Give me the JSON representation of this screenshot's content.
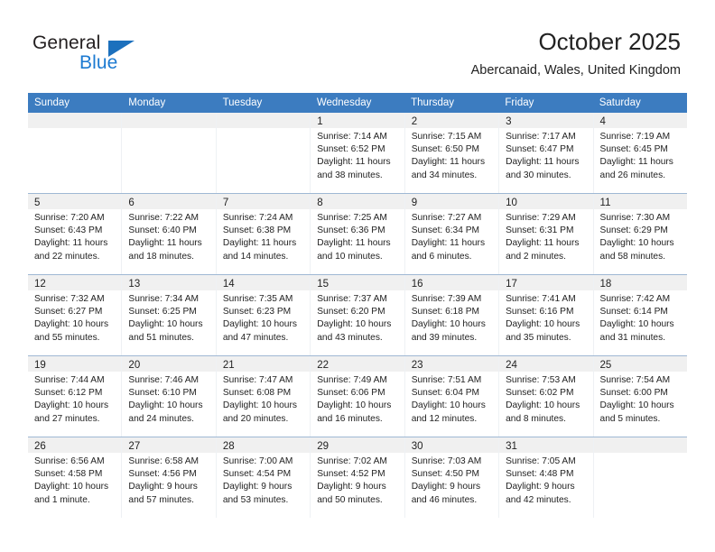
{
  "brand": {
    "name_top": "General",
    "name_bottom": "Blue",
    "triangle_color": "#1c70bd",
    "blue_color": "#1c7ad1"
  },
  "header": {
    "title": "October 2025",
    "subtitle": "Abercanaid, Wales, United Kingdom"
  },
  "theme": {
    "header_row_bg": "#3c7cc0",
    "daynum_bg": "#f0f0f0",
    "grid_line": "#9fb8d4",
    "text": "#222222"
  },
  "weekdays": [
    "Sunday",
    "Monday",
    "Tuesday",
    "Wednesday",
    "Thursday",
    "Friday",
    "Saturday"
  ],
  "weeks": [
    [
      {
        "day": "",
        "sunrise": "",
        "sunset": "",
        "daylight1": "",
        "daylight2": ""
      },
      {
        "day": "",
        "sunrise": "",
        "sunset": "",
        "daylight1": "",
        "daylight2": ""
      },
      {
        "day": "",
        "sunrise": "",
        "sunset": "",
        "daylight1": "",
        "daylight2": ""
      },
      {
        "day": "1",
        "sunrise": "Sunrise: 7:14 AM",
        "sunset": "Sunset: 6:52 PM",
        "daylight1": "Daylight: 11 hours",
        "daylight2": "and 38 minutes."
      },
      {
        "day": "2",
        "sunrise": "Sunrise: 7:15 AM",
        "sunset": "Sunset: 6:50 PM",
        "daylight1": "Daylight: 11 hours",
        "daylight2": "and 34 minutes."
      },
      {
        "day": "3",
        "sunrise": "Sunrise: 7:17 AM",
        "sunset": "Sunset: 6:47 PM",
        "daylight1": "Daylight: 11 hours",
        "daylight2": "and 30 minutes."
      },
      {
        "day": "4",
        "sunrise": "Sunrise: 7:19 AM",
        "sunset": "Sunset: 6:45 PM",
        "daylight1": "Daylight: 11 hours",
        "daylight2": "and 26 minutes."
      }
    ],
    [
      {
        "day": "5",
        "sunrise": "Sunrise: 7:20 AM",
        "sunset": "Sunset: 6:43 PM",
        "daylight1": "Daylight: 11 hours",
        "daylight2": "and 22 minutes."
      },
      {
        "day": "6",
        "sunrise": "Sunrise: 7:22 AM",
        "sunset": "Sunset: 6:40 PM",
        "daylight1": "Daylight: 11 hours",
        "daylight2": "and 18 minutes."
      },
      {
        "day": "7",
        "sunrise": "Sunrise: 7:24 AM",
        "sunset": "Sunset: 6:38 PM",
        "daylight1": "Daylight: 11 hours",
        "daylight2": "and 14 minutes."
      },
      {
        "day": "8",
        "sunrise": "Sunrise: 7:25 AM",
        "sunset": "Sunset: 6:36 PM",
        "daylight1": "Daylight: 11 hours",
        "daylight2": "and 10 minutes."
      },
      {
        "day": "9",
        "sunrise": "Sunrise: 7:27 AM",
        "sunset": "Sunset: 6:34 PM",
        "daylight1": "Daylight: 11 hours",
        "daylight2": "and 6 minutes."
      },
      {
        "day": "10",
        "sunrise": "Sunrise: 7:29 AM",
        "sunset": "Sunset: 6:31 PM",
        "daylight1": "Daylight: 11 hours",
        "daylight2": "and 2 minutes."
      },
      {
        "day": "11",
        "sunrise": "Sunrise: 7:30 AM",
        "sunset": "Sunset: 6:29 PM",
        "daylight1": "Daylight: 10 hours",
        "daylight2": "and 58 minutes."
      }
    ],
    [
      {
        "day": "12",
        "sunrise": "Sunrise: 7:32 AM",
        "sunset": "Sunset: 6:27 PM",
        "daylight1": "Daylight: 10 hours",
        "daylight2": "and 55 minutes."
      },
      {
        "day": "13",
        "sunrise": "Sunrise: 7:34 AM",
        "sunset": "Sunset: 6:25 PM",
        "daylight1": "Daylight: 10 hours",
        "daylight2": "and 51 minutes."
      },
      {
        "day": "14",
        "sunrise": "Sunrise: 7:35 AM",
        "sunset": "Sunset: 6:23 PM",
        "daylight1": "Daylight: 10 hours",
        "daylight2": "and 47 minutes."
      },
      {
        "day": "15",
        "sunrise": "Sunrise: 7:37 AM",
        "sunset": "Sunset: 6:20 PM",
        "daylight1": "Daylight: 10 hours",
        "daylight2": "and 43 minutes."
      },
      {
        "day": "16",
        "sunrise": "Sunrise: 7:39 AM",
        "sunset": "Sunset: 6:18 PM",
        "daylight1": "Daylight: 10 hours",
        "daylight2": "and 39 minutes."
      },
      {
        "day": "17",
        "sunrise": "Sunrise: 7:41 AM",
        "sunset": "Sunset: 6:16 PM",
        "daylight1": "Daylight: 10 hours",
        "daylight2": "and 35 minutes."
      },
      {
        "day": "18",
        "sunrise": "Sunrise: 7:42 AM",
        "sunset": "Sunset: 6:14 PM",
        "daylight1": "Daylight: 10 hours",
        "daylight2": "and 31 minutes."
      }
    ],
    [
      {
        "day": "19",
        "sunrise": "Sunrise: 7:44 AM",
        "sunset": "Sunset: 6:12 PM",
        "daylight1": "Daylight: 10 hours",
        "daylight2": "and 27 minutes."
      },
      {
        "day": "20",
        "sunrise": "Sunrise: 7:46 AM",
        "sunset": "Sunset: 6:10 PM",
        "daylight1": "Daylight: 10 hours",
        "daylight2": "and 24 minutes."
      },
      {
        "day": "21",
        "sunrise": "Sunrise: 7:47 AM",
        "sunset": "Sunset: 6:08 PM",
        "daylight1": "Daylight: 10 hours",
        "daylight2": "and 20 minutes."
      },
      {
        "day": "22",
        "sunrise": "Sunrise: 7:49 AM",
        "sunset": "Sunset: 6:06 PM",
        "daylight1": "Daylight: 10 hours",
        "daylight2": "and 16 minutes."
      },
      {
        "day": "23",
        "sunrise": "Sunrise: 7:51 AM",
        "sunset": "Sunset: 6:04 PM",
        "daylight1": "Daylight: 10 hours",
        "daylight2": "and 12 minutes."
      },
      {
        "day": "24",
        "sunrise": "Sunrise: 7:53 AM",
        "sunset": "Sunset: 6:02 PM",
        "daylight1": "Daylight: 10 hours",
        "daylight2": "and 8 minutes."
      },
      {
        "day": "25",
        "sunrise": "Sunrise: 7:54 AM",
        "sunset": "Sunset: 6:00 PM",
        "daylight1": "Daylight: 10 hours",
        "daylight2": "and 5 minutes."
      }
    ],
    [
      {
        "day": "26",
        "sunrise": "Sunrise: 6:56 AM",
        "sunset": "Sunset: 4:58 PM",
        "daylight1": "Daylight: 10 hours",
        "daylight2": "and 1 minute."
      },
      {
        "day": "27",
        "sunrise": "Sunrise: 6:58 AM",
        "sunset": "Sunset: 4:56 PM",
        "daylight1": "Daylight: 9 hours",
        "daylight2": "and 57 minutes."
      },
      {
        "day": "28",
        "sunrise": "Sunrise: 7:00 AM",
        "sunset": "Sunset: 4:54 PM",
        "daylight1": "Daylight: 9 hours",
        "daylight2": "and 53 minutes."
      },
      {
        "day": "29",
        "sunrise": "Sunrise: 7:02 AM",
        "sunset": "Sunset: 4:52 PM",
        "daylight1": "Daylight: 9 hours",
        "daylight2": "and 50 minutes."
      },
      {
        "day": "30",
        "sunrise": "Sunrise: 7:03 AM",
        "sunset": "Sunset: 4:50 PM",
        "daylight1": "Daylight: 9 hours",
        "daylight2": "and 46 minutes."
      },
      {
        "day": "31",
        "sunrise": "Sunrise: 7:05 AM",
        "sunset": "Sunset: 4:48 PM",
        "daylight1": "Daylight: 9 hours",
        "daylight2": "and 42 minutes."
      },
      {
        "day": "",
        "sunrise": "",
        "sunset": "",
        "daylight1": "",
        "daylight2": ""
      }
    ]
  ]
}
